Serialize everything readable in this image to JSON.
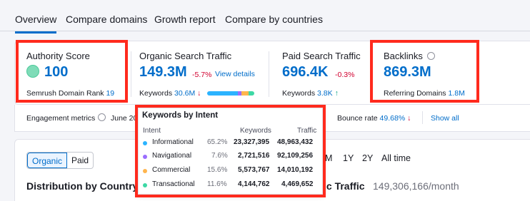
{
  "tabs": [
    "Overview",
    "Compare domains",
    "Growth report",
    "Compare by countries"
  ],
  "authority": {
    "title": "Authority Score",
    "value": "100",
    "rank_label": "Semrush Domain Rank",
    "rank_value": "19"
  },
  "organic": {
    "title": "Organic Search Traffic",
    "value": "149.3M",
    "change": "-5.7%",
    "link": "View details",
    "keywords_label": "Keywords",
    "keywords_value": "30.6M",
    "arrow": "↓"
  },
  "paid": {
    "title": "Paid Search Traffic",
    "value": "696.4K",
    "change": "-0.3%",
    "keywords_label": "Keywords",
    "keywords_value": "3.8K",
    "arrow": "↑"
  },
  "backlinks": {
    "title": "Backlinks",
    "value": "869.3M",
    "ref_label": "Referring Domains",
    "ref_value": "1.8M"
  },
  "engagement": {
    "label": "Engagement metrics",
    "date": "June 20",
    "bounce_label": "Bounce rate",
    "bounce_value": "49.68%",
    "arrow": "↓",
    "show_all": "Show all"
  },
  "lower": {
    "seg_organic": "Organic",
    "seg_paid": "Paid",
    "dist_title": "Distribution by Country",
    "ranges": [
      "M",
      "1Y",
      "2Y",
      "All time"
    ],
    "traffic_title": "ic Traffic",
    "traffic_value": "149,306,166/month"
  },
  "popup": {
    "title": "Keywords by Intent",
    "headers": {
      "intent": "Intent",
      "keywords": "Keywords",
      "traffic": "Traffic"
    },
    "rows": [
      {
        "intent": "Informational",
        "pct": "65.2%",
        "keywords": "23,327,395",
        "traffic": "48,963,432",
        "color": "#2bb3ff"
      },
      {
        "intent": "Navigational",
        "pct": "7.6%",
        "keywords": "2,721,516",
        "traffic": "92,109,256",
        "color": "#9a6dff"
      },
      {
        "intent": "Commercial",
        "pct": "15.6%",
        "keywords": "5,573,767",
        "traffic": "14,010,192",
        "color": "#ffb54d"
      },
      {
        "intent": "Transactional",
        "pct": "11.6%",
        "keywords": "4,144,762",
        "traffic": "4,469,652",
        "color": "#3dd8a5"
      }
    ]
  },
  "colors": {
    "accent": "#006dca",
    "highlight": "#ff2a1d",
    "negative": "#d1002f",
    "positive": "#009f81"
  }
}
